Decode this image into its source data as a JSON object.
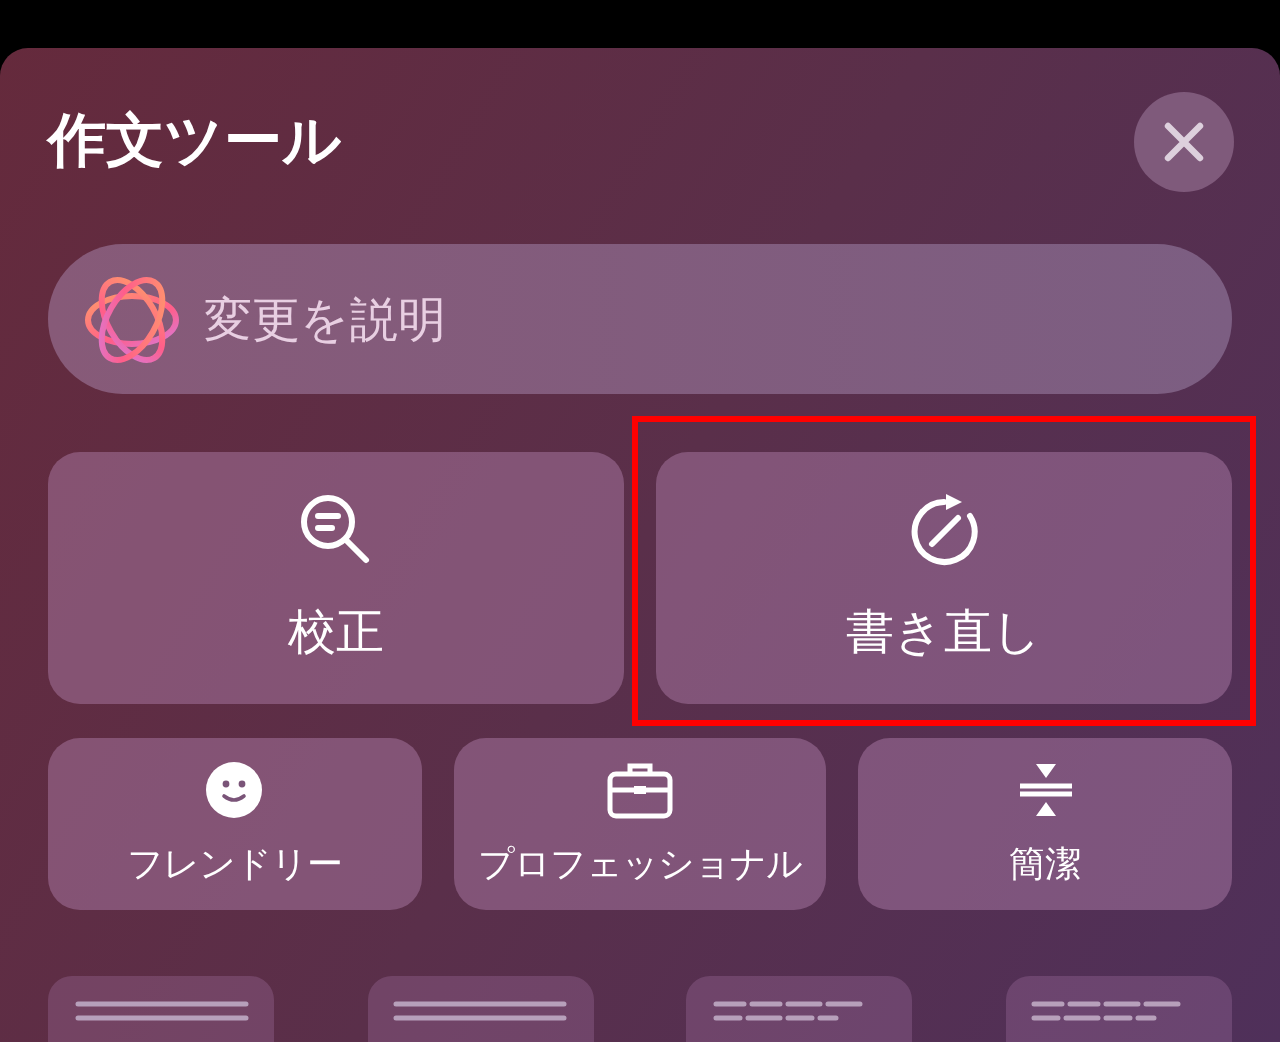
{
  "sheet": {
    "title": "作文ツール"
  },
  "describe_field": {
    "placeholder": "変更を説明"
  },
  "main_tools": [
    {
      "kind": "proofread",
      "label": "校正",
      "highlighted": false
    },
    {
      "kind": "rewrite",
      "label": "書き直し",
      "highlighted": true
    }
  ],
  "tone_tools": [
    {
      "kind": "friendly",
      "label": "フレンドリー"
    },
    {
      "kind": "professional",
      "label": "プロフェッショナル"
    },
    {
      "kind": "concise",
      "label": "簡潔"
    }
  ],
  "format_tools": [
    {
      "kind": "lines"
    },
    {
      "kind": "lines"
    },
    {
      "kind": "dashes"
    },
    {
      "kind": "dashes"
    }
  ]
}
